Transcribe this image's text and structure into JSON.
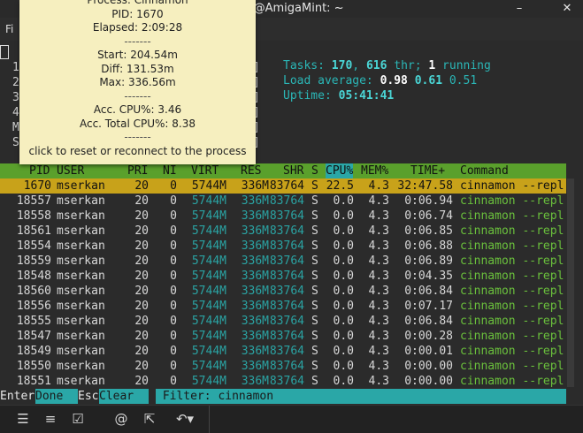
{
  "window": {
    "title": "an@AmigaMint: ~",
    "minimize": "–",
    "close": "✕"
  },
  "menubar": {
    "first": "Fi"
  },
  "meters": {
    "rows": [
      {
        "label": "1",
        "bracket": "]"
      },
      {
        "label": "2",
        "bracket": "]"
      },
      {
        "label": "3",
        "bracket": "]"
      },
      {
        "label": "4",
        "bracket": "]"
      },
      {
        "label": "M",
        "bracket": "]"
      },
      {
        "label": "S",
        "bracket": "]"
      }
    ]
  },
  "stats": {
    "tasks_label": "Tasks: ",
    "tasks": "170",
    "sep": ", ",
    "threads": "616",
    "thr_label": " thr; ",
    "running": "1",
    "running_label": " running",
    "load_label": "Load average: ",
    "load1": "0.98",
    "load5": "0.61",
    "load15": "0.51",
    "uptime_label": "Uptime: ",
    "uptime": "05:41:41"
  },
  "header": {
    "pid": "PID",
    "user": "USER",
    "pri": "PRI",
    "ni": "NI",
    "virt": "VIRT",
    "res": "RES",
    "shr": "SHR",
    "s": "S",
    "cpu": "CPU%",
    "mem": "MEM%",
    "time": "TIME+",
    "command": "Command"
  },
  "rows": [
    {
      "pid": "1670",
      "user": "mserkan",
      "pri": "20",
      "ni": "0",
      "virt": "5744M",
      "res": "336M",
      "shr": "83764",
      "s": "S",
      "cpu": "22.5",
      "mem": "4.3",
      "time": "32:47.58",
      "cmd": "cinnamon --repl"
    },
    {
      "pid": "18557",
      "user": "mserkan",
      "pri": "20",
      "ni": "0",
      "virt": "5744M",
      "res": "336M",
      "shr": "83764",
      "s": "S",
      "cpu": "0.0",
      "mem": "4.3",
      "time": "0:06.94",
      "cmd": "cinnamon --repl"
    },
    {
      "pid": "18558",
      "user": "mserkan",
      "pri": "20",
      "ni": "0",
      "virt": "5744M",
      "res": "336M",
      "shr": "83764",
      "s": "S",
      "cpu": "0.0",
      "mem": "4.3",
      "time": "0:06.74",
      "cmd": "cinnamon --repl"
    },
    {
      "pid": "18561",
      "user": "mserkan",
      "pri": "20",
      "ni": "0",
      "virt": "5744M",
      "res": "336M",
      "shr": "83764",
      "s": "S",
      "cpu": "0.0",
      "mem": "4.3",
      "time": "0:06.85",
      "cmd": "cinnamon --repl"
    },
    {
      "pid": "18554",
      "user": "mserkan",
      "pri": "20",
      "ni": "0",
      "virt": "5744M",
      "res": "336M",
      "shr": "83764",
      "s": "S",
      "cpu": "0.0",
      "mem": "4.3",
      "time": "0:06.88",
      "cmd": "cinnamon --repl"
    },
    {
      "pid": "18559",
      "user": "mserkan",
      "pri": "20",
      "ni": "0",
      "virt": "5744M",
      "res": "336M",
      "shr": "83764",
      "s": "S",
      "cpu": "0.0",
      "mem": "4.3",
      "time": "0:06.89",
      "cmd": "cinnamon --repl"
    },
    {
      "pid": "18548",
      "user": "mserkan",
      "pri": "20",
      "ni": "0",
      "virt": "5744M",
      "res": "336M",
      "shr": "83764",
      "s": "S",
      "cpu": "0.0",
      "mem": "4.3",
      "time": "0:04.35",
      "cmd": "cinnamon --repl"
    },
    {
      "pid": "18560",
      "user": "mserkan",
      "pri": "20",
      "ni": "0",
      "virt": "5744M",
      "res": "336M",
      "shr": "83764",
      "s": "S",
      "cpu": "0.0",
      "mem": "4.3",
      "time": "0:06.84",
      "cmd": "cinnamon --repl"
    },
    {
      "pid": "18556",
      "user": "mserkan",
      "pri": "20",
      "ni": "0",
      "virt": "5744M",
      "res": "336M",
      "shr": "83764",
      "s": "S",
      "cpu": "0.0",
      "mem": "4.3",
      "time": "0:07.17",
      "cmd": "cinnamon --repl"
    },
    {
      "pid": "18555",
      "user": "mserkan",
      "pri": "20",
      "ni": "0",
      "virt": "5744M",
      "res": "336M",
      "shr": "83764",
      "s": "S",
      "cpu": "0.0",
      "mem": "4.3",
      "time": "0:06.84",
      "cmd": "cinnamon --repl"
    },
    {
      "pid": "18547",
      "user": "mserkan",
      "pri": "20",
      "ni": "0",
      "virt": "5744M",
      "res": "336M",
      "shr": "83764",
      "s": "S",
      "cpu": "0.0",
      "mem": "4.3",
      "time": "0:00.28",
      "cmd": "cinnamon --repl"
    },
    {
      "pid": "18549",
      "user": "mserkan",
      "pri": "20",
      "ni": "0",
      "virt": "5744M",
      "res": "336M",
      "shr": "83764",
      "s": "S",
      "cpu": "0.0",
      "mem": "4.3",
      "time": "0:00.01",
      "cmd": "cinnamon --repl"
    },
    {
      "pid": "18550",
      "user": "mserkan",
      "pri": "20",
      "ni": "0",
      "virt": "5744M",
      "res": "336M",
      "shr": "83764",
      "s": "S",
      "cpu": "0.0",
      "mem": "4.3",
      "time": "0:00.00",
      "cmd": "cinnamon --repl"
    },
    {
      "pid": "18551",
      "user": "mserkan",
      "pri": "20",
      "ni": "0",
      "virt": "5744M",
      "res": "336M",
      "shr": "83764",
      "s": "S",
      "cpu": "0.0",
      "mem": "4.3",
      "time": "0:00.00",
      "cmd": "cinnamon --repl"
    }
  ],
  "footer": {
    "enter_key": "Enter",
    "enter_label": "Done",
    "esc_key": "Esc",
    "esc_label": "Clear",
    "filter": "Filter: cinnamon"
  },
  "tooltip": {
    "process": "Process: Cinnamon",
    "pid": "PID: 1670",
    "elapsed": "Elapsed: 2:09:28",
    "sep": "-------",
    "start": "Start: 204.54m",
    "diff": "Diff: 131.53m",
    "max": "Max: 336.56m",
    "acc_cpu": "Acc. CPU%: 3.46",
    "acc_total": "Acc. Total CPU%: 8.38",
    "hint": "click to reset or reconnect to the process"
  },
  "toolbar": {
    "icons": [
      "list-icon",
      "numbered-list-icon",
      "checkbox-icon",
      "mention-icon",
      "external-link-icon",
      "undo-icon"
    ]
  },
  "colors": {
    "header": "#5aa02c",
    "selected": "#c8a21a",
    "accent": "#2aa7a7",
    "tooltip": "#f6efbf"
  }
}
